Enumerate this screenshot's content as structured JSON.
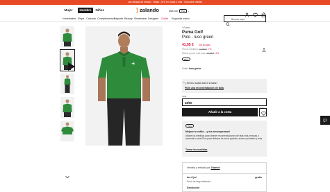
{
  "promo_bar": {
    "text": "Las rebajas de verano · Hasta -70% en moda y más · Descubre ofertas"
  },
  "header": {
    "gender_tabs": [
      {
        "label": "Mujer",
        "active": false
      },
      {
        "label": "Hombre",
        "active": true
      },
      {
        "label": "Niños",
        "active": false
      }
    ],
    "logo_text": "zalando",
    "plus_label": "Más con",
    "plus_badge": "Plus",
    "icons": [
      "user-icon",
      "heart-icon",
      "bag-icon"
    ]
  },
  "categories": [
    "Novedades",
    "Ropa",
    "Calzado",
    "Complementos",
    "Deporte",
    "Beauty",
    "Streetwear",
    "Designer",
    "Outlet",
    "Segunda mano"
  ],
  "search": {
    "placeholder": "Buscar aquí"
  },
  "thumbnails": {
    "count": 5,
    "selected_index": 1,
    "icons": [
      "play-icon"
    ]
  },
  "product": {
    "breadcrumb": "Polos",
    "brand": "Puma Golf",
    "name": "Polo - luso green",
    "price": "41,95 €",
    "vat_note": "IVA incluido",
    "recent_price_label": "Precio mediano:",
    "recent_price_old": "44,95 €",
    "recent_price_discount": "-7%",
    "lowest_label": "Último precio más bajo:",
    "lowest_old": "46,95 €",
    "lowest_discount": "-9%",
    "plus_tag": "Plus",
    "color_label": "Color:",
    "color_value": "luso green"
  },
  "size_help": {
    "question": "¿Tienes dudas sobre la talla?",
    "link": "Pide una recomendación de talla"
  },
  "size": {
    "label": "Talla",
    "value": "48/50"
  },
  "add_to_cart": {
    "label": "Añadir a la cesta"
  },
  "plus_promo": {
    "tag": "Plus",
    "title": "Mejora tu estilo... y tus recompensas!",
    "body": "Añade tus medidas para obtener recomendaciones de talla más precisas y aumenta tu nivel Plus para disfrutar de envío gratuito, acceso prioritario y más.",
    "cta": "Tomar las medidas"
  },
  "shipping": {
    "sold_by_label": "Vendido y enviado por",
    "sold_by": "Zalando",
    "date": "lun 8 jul",
    "price": "gratis",
    "method": "Envío de largo distancia",
    "returns": "Devolución"
  },
  "colors": {
    "accent_red": "#d6173f",
    "promo_orange": "#e84a25",
    "logo_orange": "#ff6900",
    "shirt_green": "#2e8b3c",
    "dark": "#1a1a1a"
  }
}
